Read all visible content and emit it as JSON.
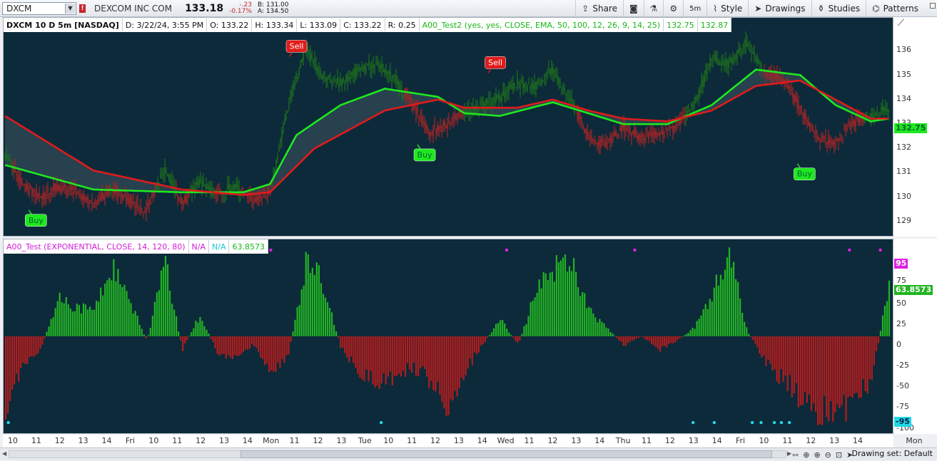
{
  "toolbar": {
    "symbol": "DXCM",
    "alert_badge": "!",
    "company": "DEXCOM INC COM",
    "last": "133.18",
    "net_change": "-.23",
    "pct_change": "-0.17%",
    "bid": "B: 131.00",
    "ask": "A: 134.50",
    "share": "Share",
    "aggregation": "5m",
    "style": "Style",
    "drawings": "Drawings",
    "studies": "Studies",
    "patterns": "Patterns"
  },
  "upper_legend": {
    "symbol": "DXCM 10 D 5m [NASDAQ]",
    "date": "D: 3/22/24, 3:55 PM",
    "open": "O: 133.22",
    "high": "H: 133.34",
    "low": "L: 133.09",
    "close": "C: 133.22",
    "range": "R: 0.25",
    "study": "A00_Test2 (yes, yes, CLOSE, EMA, 50, 100, 12, 26, 9, 14, 25)",
    "value1": "132.75",
    "value2": "132.87"
  },
  "lower_legend": {
    "study": "A00_Test (EXPONENTIAL, CLOSE, 14, 120, 80)",
    "value1": "N/A",
    "value2": "N/A",
    "value3": "63.8573"
  },
  "upper_axis": {
    "ticks": [
      "136",
      "135",
      "134",
      "133",
      "132",
      "131",
      "130",
      "129"
    ],
    "price_tag": "132.75"
  },
  "lower_axis": {
    "ticks": [
      "75",
      "50",
      "25",
      "0",
      "-25",
      "-50",
      "-75",
      "-100"
    ],
    "top_tag": "95",
    "value_tag": "63.8573",
    "bottom_tag": "-95"
  },
  "time_axis": {
    "labels": [
      "10",
      "11",
      "12",
      "13",
      "14",
      "Fri",
      "10",
      "11",
      "12",
      "13",
      "14",
      "Mon",
      "11",
      "12",
      "13",
      "Tue",
      "10",
      "11",
      "12",
      "13",
      "14",
      "Wed",
      "11",
      "12",
      "13",
      "14",
      "Thu",
      "11",
      "12",
      "13",
      "14",
      "Fri",
      "10",
      "11",
      "12",
      "13",
      "14"
    ],
    "last_label": "Mon"
  },
  "signals": {
    "buy": "Buy",
    "sell": "Sell"
  },
  "status": {
    "drawing_set": "Drawing set: Default"
  },
  "colors": {
    "background": "#0c2a3a",
    "bull": "#22b422",
    "bear": "#b51c1c",
    "ema_fast": "#1fe81f",
    "ema_slow": "#e01b1b",
    "signal_top": "#e020e0",
    "signal_bottom": "#20d8e8"
  },
  "chart_data": [
    {
      "type": "line",
      "title": "DXCM 10 D 5m [NASDAQ]",
      "ylim": [
        128.5,
        136.5
      ],
      "price_path_x": [
        0,
        0.02,
        0.04,
        0.06,
        0.08,
        0.1,
        0.12,
        0.14,
        0.16,
        0.18,
        0.2,
        0.22,
        0.24,
        0.26,
        0.28,
        0.3,
        0.32,
        0.34,
        0.36,
        0.38,
        0.4,
        0.42,
        0.44,
        0.46,
        0.48,
        0.5,
        0.52,
        0.54,
        0.56,
        0.58,
        0.6,
        0.62,
        0.64,
        0.66,
        0.68,
        0.7,
        0.72,
        0.74,
        0.76,
        0.78,
        0.8,
        0.82,
        0.84,
        0.86,
        0.88,
        0.9,
        0.92,
        0.94,
        0.96,
        0.98,
        1.0
      ],
      "price": [
        131.5,
        130.4,
        129.9,
        130.3,
        130.1,
        129.6,
        130.2,
        129.8,
        129.4,
        130.9,
        129.7,
        130.5,
        130.0,
        130.3,
        129.8,
        130.1,
        133.2,
        135.4,
        134.3,
        134.1,
        134.6,
        134.8,
        134.3,
        133.4,
        132.3,
        132.6,
        133.0,
        133.3,
        133.6,
        134.1,
        134.0,
        134.6,
        133.5,
        132.1,
        131.8,
        132.5,
        132.1,
        132.3,
        132.5,
        133.3,
        135.0,
        134.8,
        135.6,
        134.4,
        134.3,
        133.2,
        132.1,
        131.9,
        132.7,
        132.9,
        133.2
      ],
      "ema_fast_x": [
        0,
        0.1,
        0.2,
        0.27,
        0.3,
        0.33,
        0.38,
        0.43,
        0.49,
        0.52,
        0.56,
        0.62,
        0.66,
        0.7,
        0.75,
        0.8,
        0.85,
        0.9,
        0.94,
        0.98,
        1.0
      ],
      "ema_fast": [
        131.1,
        130.2,
        130.1,
        130.1,
        130.4,
        132.2,
        133.3,
        133.9,
        133.6,
        133.0,
        132.9,
        133.4,
        133.0,
        132.6,
        132.6,
        133.3,
        134.6,
        134.4,
        133.3,
        132.7,
        132.8
      ],
      "ema_slow_x": [
        0,
        0.1,
        0.2,
        0.27,
        0.3,
        0.35,
        0.43,
        0.49,
        0.52,
        0.58,
        0.62,
        0.66,
        0.7,
        0.75,
        0.8,
        0.85,
        0.9,
        0.94,
        0.98,
        1.0
      ],
      "ema_slow": [
        132.9,
        130.9,
        130.2,
        130.0,
        130.1,
        131.7,
        133.1,
        133.5,
        133.2,
        133.2,
        133.5,
        133.1,
        132.8,
        132.7,
        133.1,
        134.0,
        134.2,
        133.5,
        132.8,
        132.8
      ],
      "signals": [
        {
          "type": "Buy",
          "x": 0.035,
          "y": 129.5
        },
        {
          "type": "Sell",
          "x": 0.33,
          "y": 135.0
        },
        {
          "type": "Buy",
          "x": 0.475,
          "y": 131.9
        },
        {
          "type": "Sell",
          "x": 0.555,
          "y": 134.4
        },
        {
          "type": "Buy",
          "x": 0.905,
          "y": 131.2
        }
      ]
    },
    {
      "type": "bar",
      "title": "A00_Test (EXPONENTIAL, CLOSE, 14, 120, 80)",
      "ylim": [
        -105,
        105
      ],
      "x": [
        0,
        0.02,
        0.04,
        0.06,
        0.08,
        0.1,
        0.12,
        0.14,
        0.16,
        0.18,
        0.2,
        0.22,
        0.24,
        0.26,
        0.28,
        0.3,
        0.32,
        0.34,
        0.36,
        0.38,
        0.4,
        0.42,
        0.44,
        0.46,
        0.48,
        0.5,
        0.52,
        0.54,
        0.56,
        0.58,
        0.6,
        0.62,
        0.64,
        0.66,
        0.68,
        0.7,
        0.72,
        0.74,
        0.76,
        0.78,
        0.8,
        0.82,
        0.84,
        0.86,
        0.88,
        0.9,
        0.92,
        0.94,
        0.96,
        0.98,
        1.0
      ],
      "values": [
        -95,
        -30,
        -15,
        45,
        35,
        30,
        80,
        40,
        -5,
        85,
        -15,
        25,
        -20,
        -25,
        -10,
        -45,
        -20,
        85,
        60,
        -15,
        -40,
        -55,
        -45,
        -35,
        -50,
        -85,
        -40,
        -10,
        20,
        -10,
        50,
        80,
        90,
        30,
        10,
        -10,
        0,
        -15,
        -5,
        10,
        50,
        90,
        5,
        -30,
        -50,
        -70,
        -85,
        -95,
        -70,
        -50,
        60
      ],
      "top_signals_x": [
        0.095,
        0.14,
        0.283,
        0.3,
        0.567,
        0.712,
        0.955,
        0.99
      ],
      "bottom_signals_x": [
        0.003,
        0.425,
        0.778,
        0.802,
        0.845,
        0.855,
        0.87,
        0.878,
        0.887
      ]
    }
  ]
}
